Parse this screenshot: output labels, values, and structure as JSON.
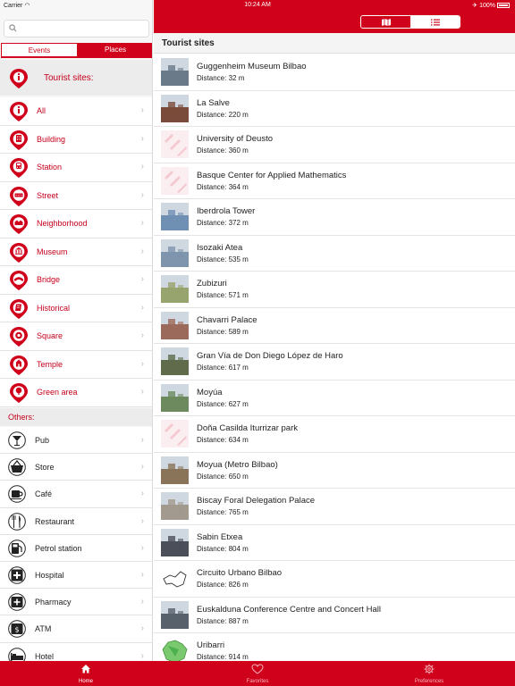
{
  "status": {
    "carrier": "Carrier",
    "time": "10:24 AM",
    "battery": "100%"
  },
  "search": {
    "placeholder": ""
  },
  "segments": {
    "events": "Events",
    "places": "Places"
  },
  "tourist_header": "Tourist sites:",
  "categories": [
    {
      "label": "All",
      "icon": "info-icon"
    },
    {
      "label": "Building",
      "icon": "building-icon"
    },
    {
      "label": "Station",
      "icon": "train-icon"
    },
    {
      "label": "Street",
      "icon": "street-icon"
    },
    {
      "label": "Neighborhood",
      "icon": "neighborhood-icon"
    },
    {
      "label": "Museum",
      "icon": "museum-icon"
    },
    {
      "label": "Bridge",
      "icon": "bridge-icon"
    },
    {
      "label": "Historical",
      "icon": "historical-icon"
    },
    {
      "label": "Square",
      "icon": "square-icon"
    },
    {
      "label": "Temple",
      "icon": "temple-icon"
    },
    {
      "label": "Green area",
      "icon": "tree-icon"
    }
  ],
  "others_title": "Others:",
  "others": [
    {
      "label": "Pub",
      "icon": "cocktail-icon"
    },
    {
      "label": "Store",
      "icon": "basket-icon"
    },
    {
      "label": "Café",
      "icon": "cup-icon"
    },
    {
      "label": "Restaurant",
      "icon": "cutlery-icon"
    },
    {
      "label": "Petrol station",
      "icon": "fuel-icon"
    },
    {
      "label": "Hospital",
      "icon": "hospital-icon"
    },
    {
      "label": "Pharmacy",
      "icon": "pharmacy-icon"
    },
    {
      "label": "ATM",
      "icon": "atm-icon"
    },
    {
      "label": "Hotel",
      "icon": "bed-icon"
    }
  ],
  "main": {
    "section_title": "Tourist sites",
    "sites": [
      {
        "name": "Guggenheim Museum Bilbao",
        "distance": "Distance: 32 m",
        "thumb": "#6b7a89"
      },
      {
        "name": "La Salve",
        "distance": "Distance: 220 m",
        "thumb": "#7a4b3a"
      },
      {
        "name": "University of Deusto",
        "distance": "Distance: 360 m",
        "thumb": "placeholder"
      },
      {
        "name": "Basque Center for Applied Mathematics",
        "distance": "Distance: 364 m",
        "thumb": "placeholder"
      },
      {
        "name": "Iberdrola Tower",
        "distance": "Distance: 372 m",
        "thumb": "#6f8fb3"
      },
      {
        "name": "Isozaki Atea",
        "distance": "Distance: 535 m",
        "thumb": "#7e95ad"
      },
      {
        "name": "Zubizuri",
        "distance": "Distance: 571 m",
        "thumb": "#97a46d"
      },
      {
        "name": "Chavarri Palace",
        "distance": "Distance: 589 m",
        "thumb": "#9b6a5a"
      },
      {
        "name": "Gran Vía de Don Diego López de Haro",
        "distance": "Distance: 617 m",
        "thumb": "#5f6b4b"
      },
      {
        "name": "Moyúa",
        "distance": "Distance: 627 m",
        "thumb": "#6c8a5e"
      },
      {
        "name": "Doña Casilda Iturrizar park",
        "distance": "Distance: 634 m",
        "thumb": "placeholder"
      },
      {
        "name": "Moyua (Metro Bilbao)",
        "distance": "Distance: 650 m",
        "thumb": "#8a7459"
      },
      {
        "name": "Biscay Foral Delegation Palace",
        "distance": "Distance: 765 m",
        "thumb": "#a29a8e"
      },
      {
        "name": "Sabin Etxea",
        "distance": "Distance: 804 m",
        "thumb": "#4a4f5a"
      },
      {
        "name": "Circuito Urbano Bilbao",
        "distance": "Distance: 826 m",
        "thumb": "map"
      },
      {
        "name": "Euskalduna Conference Centre and Concert Hall",
        "distance": "Distance: 887 m",
        "thumb": "#58616b"
      },
      {
        "name": "Uribarri",
        "distance": "Distance: 914 m",
        "thumb": "green-map"
      }
    ]
  },
  "tabs": [
    {
      "label": "Home",
      "icon": "home-icon",
      "active": true
    },
    {
      "label": "Favorites",
      "icon": "heart-icon",
      "active": false
    },
    {
      "label": "Preferences",
      "icon": "gear-icon",
      "active": false
    }
  ],
  "colors": {
    "accent": "#d0021b"
  }
}
